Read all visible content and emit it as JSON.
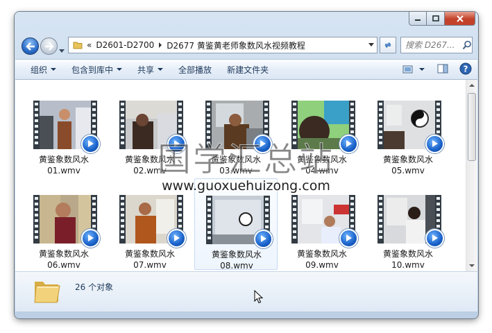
{
  "address": {
    "overflow_glyph": "«",
    "crumbs": [
      "D2601-D2700",
      "D2677 黄鉴黄老师象数风水视频教程"
    ]
  },
  "search": {
    "placeholder": "搜索 D267..."
  },
  "toolbar": {
    "organize": "组织",
    "include_library": "包含到库中",
    "share": "共享",
    "play_all": "全部播放",
    "new_folder": "新建文件夹"
  },
  "files": [
    {
      "name": "黄鉴象数风水",
      "ext": "01.wmv"
    },
    {
      "name": "黄鉴象数风水",
      "ext": "02.wmv"
    },
    {
      "name": "黄鉴象数风水",
      "ext": "03.wmv"
    },
    {
      "name": "黄鉴象数风水",
      "ext": "04.wmv"
    },
    {
      "name": "黄鉴象数风水",
      "ext": "05.wmv"
    },
    {
      "name": "黄鉴象数风水",
      "ext": "06.wmv"
    },
    {
      "name": "黄鉴象数风水",
      "ext": "07.wmv"
    },
    {
      "name": "黄鉴象数风水",
      "ext": "08.wmv"
    },
    {
      "name": "黄鉴象数风水",
      "ext": "09.wmv"
    },
    {
      "name": "黄鉴象数风水",
      "ext": "10.wmv"
    }
  ],
  "selected_index": 7,
  "details": {
    "count": "26 个对象"
  },
  "watermark": {
    "chinese": "国学汇总站",
    "url": "www.guoxuehuizong.com"
  },
  "colors": {
    "accent": "#1e395b",
    "selection": "#c7daf1"
  }
}
